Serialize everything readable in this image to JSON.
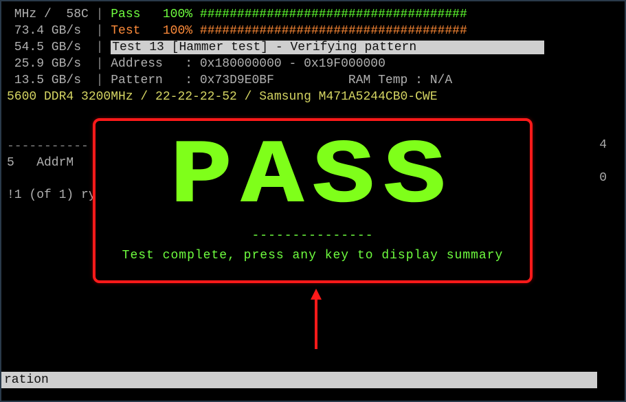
{
  "header": {
    "lines": [
      {
        "left": " MHz /  58C",
        "sep": " | ",
        "label": "Pass",
        "labelClass": "col-green",
        "pct": "100%",
        "bar": "####################################",
        "barClass": "col-hash-green"
      },
      {
        "left": " 73.4 GB/s",
        "sep": " | ",
        "label": "Test",
        "labelClass": "col-orange",
        "pct": "100%",
        "bar": "####################################",
        "barClass": "col-hash-orange"
      },
      {
        "left": " 54.5 GB/s",
        "sep": " | ",
        "inv": "Test 13 [Hammer test] - Verifying pattern                 "
      },
      {
        "left": " 25.9 GB/s",
        "sep": " | ",
        "text": "Address   : 0x180000000 - 0x19F000000"
      },
      {
        "left": " 13.5 GB/s",
        "sep": " | ",
        "text": "Pattern   : 0x73D9E0BF          RAM Temp : N/A"
      }
    ],
    "raminfo": "5600 DDR4 3200MHz / 22-22-22-52 / Samsung M471A5244CB0-CWE",
    "divider": "-----------",
    "addrLabel": "5   AddrM",
    "frag1": "!1 (of 1)",
    "frag2": "ry - this"
  },
  "rightNums": {
    "n1": "4",
    "n2": "0"
  },
  "overlay": {
    "title": "PASS",
    "separator": "---------------",
    "message": "Test complete, press any key to display summary"
  },
  "footer": {
    "text": "ration"
  }
}
